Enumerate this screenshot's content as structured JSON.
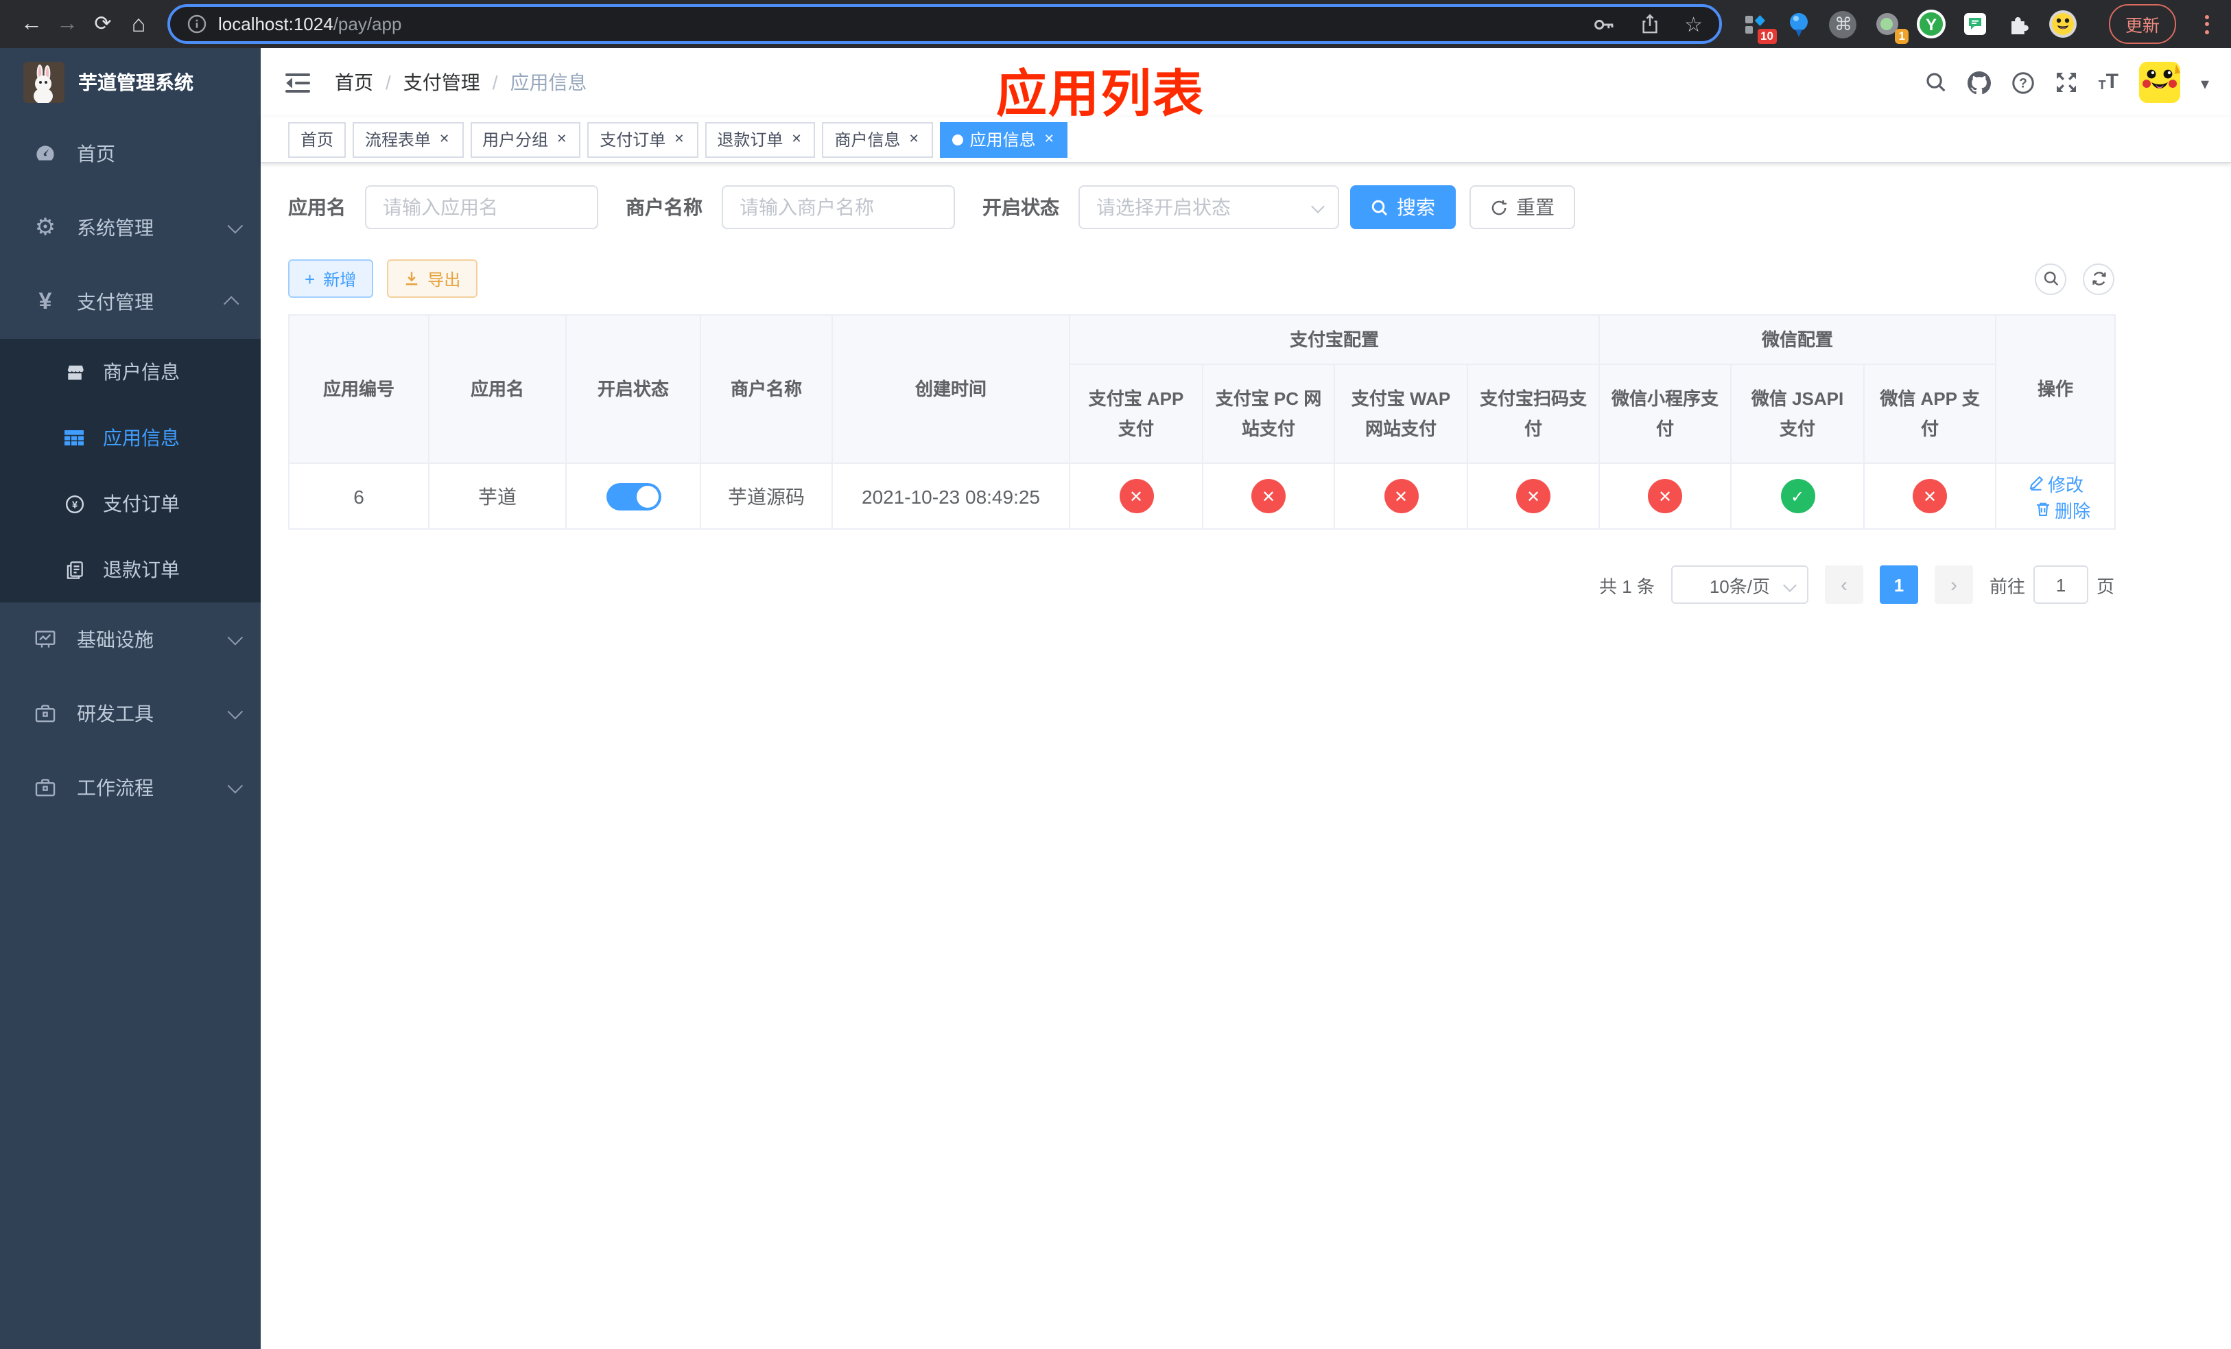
{
  "browser": {
    "url_host": "localhost:1024",
    "url_path": "/pay/app",
    "update_label": "更新",
    "ext1_badge": "10",
    "ext4_badge": "1",
    "ext5_letter": "Y"
  },
  "annotation": {
    "title": "应用列表"
  },
  "sidebar": {
    "title": "芋道管理系统",
    "items": {
      "home": "首页",
      "system": "系统管理",
      "payment": "支付管理",
      "merchant": "商户信息",
      "app": "应用信息",
      "pay_order": "支付订单",
      "refund_order": "退款订单",
      "infra": "基础设施",
      "dev_tools": "研发工具",
      "workflow": "工作流程"
    }
  },
  "navbar": {
    "breadcrumb": [
      "首页",
      "支付管理",
      "应用信息"
    ]
  },
  "tabs": [
    "首页",
    "流程表单",
    "用户分组",
    "支付订单",
    "退款订单",
    "商户信息",
    "应用信息"
  ],
  "filters": {
    "app_name_label": "应用名",
    "app_name_placeholder": "请输入应用名",
    "merchant_label": "商户名称",
    "merchant_placeholder": "请输入商户名称",
    "status_label": "开启状态",
    "status_placeholder": "请选择开启状态",
    "search_label": "搜索",
    "reset_label": "重置"
  },
  "toolbar": {
    "add_label": "新增",
    "export_label": "导出"
  },
  "table": {
    "groups": {
      "alipay": "支付宝配置",
      "wechat": "微信配置"
    },
    "columns": [
      "应用编号",
      "应用名",
      "开启状态",
      "商户名称",
      "创建时间",
      "支付宝 APP 支付",
      "支付宝 PC 网站支付",
      "支付宝 WAP 网站支付",
      "支付宝扫码支付",
      "微信小程序支付",
      "微信 JSAPI 支付",
      "微信 APP 支付",
      "操作"
    ],
    "row": {
      "id": "6",
      "name": "芋道",
      "enabled": "on",
      "merchant": "芋道源码",
      "created": "2021-10-23 08:49:25",
      "statuses": [
        "disabled",
        "disabled",
        "disabled",
        "disabled",
        "disabled",
        "enabled",
        "disabled"
      ],
      "edit_label": "修改",
      "delete_label": "删除"
    }
  },
  "pagination": {
    "total": "共 1 条",
    "page_size": "10条/页",
    "page": "1",
    "goto_label": "前往",
    "goto_value": "1",
    "unit_label": "页"
  },
  "colors": {
    "primary": "#409eff",
    "danger": "#f5504e",
    "success": "#23bd66",
    "warning": "#e6a23c",
    "sidebar_bg": "#304156",
    "submenu_bg": "#1f2d3d",
    "annotation_red": "#ff2b00"
  }
}
